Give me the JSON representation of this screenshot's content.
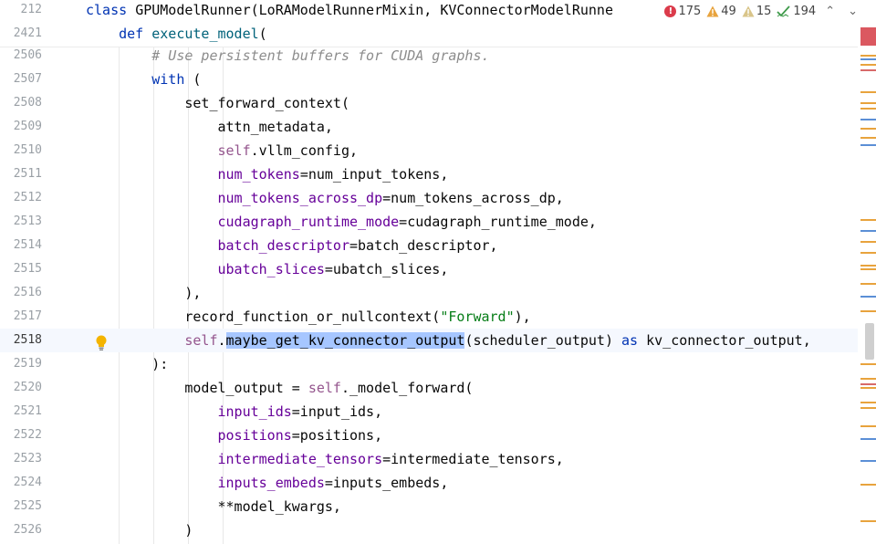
{
  "editor": {
    "sticky": [
      {
        "num": "212",
        "tokens": [
          {
            "k": "kw",
            "t": "class "
          },
          {
            "k": "id",
            "t": "GPUModelRunner(LoRAModelRunnerMixin, KVConnectorModelRunne"
          }
        ]
      },
      {
        "num": "2421",
        "tokens": [
          {
            "k": "kw",
            "t": "    def "
          },
          {
            "k": "fn",
            "t": "execute_model"
          },
          {
            "k": "id",
            "t": "("
          }
        ]
      }
    ],
    "lines": [
      {
        "num": "2506",
        "tokens": [
          {
            "k": "cm",
            "t": "        # Use persistent buffers for CUDA graphs."
          }
        ]
      },
      {
        "num": "2507",
        "tokens": [
          {
            "k": "kw",
            "t": "        with "
          },
          {
            "k": "id",
            "t": "("
          }
        ]
      },
      {
        "num": "2508",
        "tokens": [
          {
            "k": "id",
            "t": "            set_forward_context("
          }
        ]
      },
      {
        "num": "2509",
        "tokens": [
          {
            "k": "id",
            "t": "                attn_metadata,"
          }
        ]
      },
      {
        "num": "2510",
        "tokens": [
          {
            "k": "self",
            "t": "                self"
          },
          {
            "k": "id",
            "t": ".vllm_config,"
          }
        ]
      },
      {
        "num": "2511",
        "tokens": [
          {
            "k": "param",
            "t": "                num_tokens"
          },
          {
            "k": "id",
            "t": "=num_input_tokens,"
          }
        ]
      },
      {
        "num": "2512",
        "tokens": [
          {
            "k": "param",
            "t": "                num_tokens_across_dp"
          },
          {
            "k": "id",
            "t": "=num_tokens_across_dp,"
          }
        ]
      },
      {
        "num": "2513",
        "tokens": [
          {
            "k": "param",
            "t": "                cudagraph_runtime_mode"
          },
          {
            "k": "id",
            "t": "=cudagraph_runtime_mode,"
          }
        ]
      },
      {
        "num": "2514",
        "tokens": [
          {
            "k": "param",
            "t": "                batch_descriptor"
          },
          {
            "k": "id",
            "t": "=batch_descriptor,"
          }
        ]
      },
      {
        "num": "2515",
        "tokens": [
          {
            "k": "param",
            "t": "                ubatch_slices"
          },
          {
            "k": "id",
            "t": "=ubatch_slices,"
          }
        ]
      },
      {
        "num": "2516",
        "tokens": [
          {
            "k": "id",
            "t": "            ),"
          }
        ]
      },
      {
        "num": "2517",
        "tokens": [
          {
            "k": "id",
            "t": "            record_function_or_nullcontext("
          },
          {
            "k": "str",
            "t": "\"Forward\""
          },
          {
            "k": "id",
            "t": "),"
          }
        ]
      },
      {
        "num": "2518",
        "current": true,
        "tokens": [
          {
            "k": "self",
            "t": "            self"
          },
          {
            "k": "id",
            "t": "."
          },
          {
            "k": "hl",
            "t": "maybe_get_kv_connector_output"
          },
          {
            "k": "id",
            "t": "(scheduler_output) "
          },
          {
            "k": "kw",
            "t": "as"
          },
          {
            "k": "id",
            "t": " kv_connector_output,"
          }
        ]
      },
      {
        "num": "2519",
        "tokens": [
          {
            "k": "id",
            "t": "        ):"
          }
        ]
      },
      {
        "num": "2520",
        "tokens": [
          {
            "k": "id",
            "t": "            model_output = "
          },
          {
            "k": "self",
            "t": "self"
          },
          {
            "k": "id",
            "t": "._model_forward("
          }
        ]
      },
      {
        "num": "2521",
        "tokens": [
          {
            "k": "param",
            "t": "                input_ids"
          },
          {
            "k": "id",
            "t": "=input_ids,"
          }
        ]
      },
      {
        "num": "2522",
        "tokens": [
          {
            "k": "param",
            "t": "                positions"
          },
          {
            "k": "id",
            "t": "=positions,"
          }
        ]
      },
      {
        "num": "2523",
        "tokens": [
          {
            "k": "param",
            "t": "                intermediate_tensors"
          },
          {
            "k": "id",
            "t": "=intermediate_tensors,"
          }
        ]
      },
      {
        "num": "2524",
        "tokens": [
          {
            "k": "param",
            "t": "                inputs_embeds"
          },
          {
            "k": "id",
            "t": "=inputs_embeds,"
          }
        ]
      },
      {
        "num": "2525",
        "tokens": [
          {
            "k": "id",
            "t": "                **model_kwargs,"
          }
        ]
      },
      {
        "num": "2526",
        "tokens": [
          {
            "k": "id",
            "t": "            )"
          }
        ]
      }
    ]
  },
  "inspections": {
    "errors": "175",
    "warnings": "49",
    "weak_warnings": "15",
    "typos": "194"
  },
  "icons": {
    "intention": "lightbulb-icon",
    "error": "error-icon",
    "warning": "warning-icon",
    "weak_warning": "weak-warning-icon",
    "typo": "typo-check-icon",
    "prev": "chevron-up-icon",
    "next": "chevron-down-icon"
  },
  "colors": {
    "keyword": "#0033b3",
    "function": "#00627a",
    "self": "#94558d",
    "parameter": "#660099",
    "string": "#067d17",
    "comment": "#8c8c8c",
    "selection": "#a6c6ff",
    "current_line": "#f5f8fe",
    "error": "#db3b4b",
    "warning": "#e8a33d"
  }
}
